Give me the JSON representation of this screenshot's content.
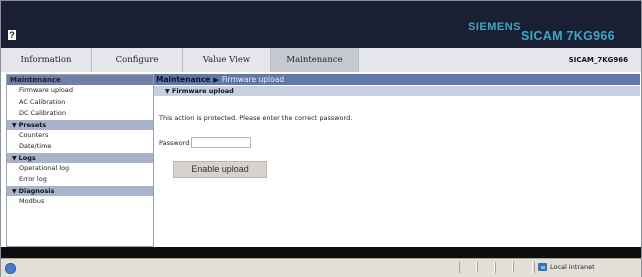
{
  "header": {
    "brand": "SIEMENS",
    "product": "SICAM 7KG966",
    "help_glyph": "?"
  },
  "tabs": [
    {
      "label": "Information",
      "active": false
    },
    {
      "label": "Configure",
      "active": false
    },
    {
      "label": "Value View",
      "active": false
    },
    {
      "label": "Maintenance",
      "active": true
    }
  ],
  "device_id": "SICAM_7KG966",
  "sidebar": {
    "title": "Maintenance",
    "items": [
      {
        "kind": "item",
        "label": "Firmware upload"
      },
      {
        "kind": "item",
        "label": "AC Calibration"
      },
      {
        "kind": "item",
        "label": "DC Calibration"
      },
      {
        "kind": "group",
        "label": "Presets"
      },
      {
        "kind": "item",
        "label": "Counters"
      },
      {
        "kind": "item",
        "label": "Date/time"
      },
      {
        "kind": "group",
        "label": "Logs"
      },
      {
        "kind": "item",
        "label": "Operational log"
      },
      {
        "kind": "item",
        "label": "Error log"
      },
      {
        "kind": "group",
        "label": "Diagnosis"
      },
      {
        "kind": "item",
        "label": "Modbus"
      }
    ]
  },
  "main": {
    "breadcrumb_root": "Maintenance",
    "breadcrumb_current": "Firmware upload",
    "section_title": "Firmware upload",
    "message": "This action is protected. Please enter the correct password.",
    "password_label": "Password",
    "password_value": "",
    "enable_button": "Enable upload"
  },
  "statusbar": {
    "zone": "Local intranet"
  },
  "icons": {
    "breadcrumb_separator": "triangle-right-icon",
    "group_toggle": "triangle-down-icon",
    "page": "ie-page-icon",
    "zone": "local-intranet-icon"
  },
  "colors": {
    "header_bg": "#1a1f33",
    "brand": "#3ea6c6",
    "breadcrumb_bg": "#5f78a8",
    "sidebar_group_bg": "#a9b3cb",
    "button_bg": "#d8d2cc"
  }
}
